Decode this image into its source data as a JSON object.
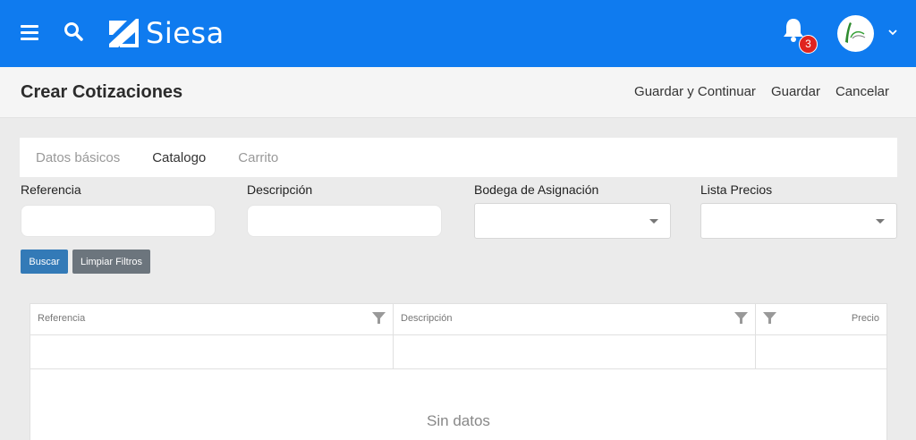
{
  "app": {
    "brand": "Siesa",
    "notifications_count": "3"
  },
  "header": {
    "title": "Crear Cotizaciones",
    "actions": [
      "Guardar y Continuar",
      "Guardar",
      "Cancelar"
    ]
  },
  "tabs": [
    {
      "label": "Datos básicos",
      "active": false
    },
    {
      "label": "Catalogo",
      "active": true
    },
    {
      "label": "Carrito",
      "active": false
    }
  ],
  "filters": {
    "referencia": {
      "label": "Referencia",
      "value": "",
      "placeholder": ""
    },
    "descripcion": {
      "label": "Descripción",
      "value": "",
      "placeholder": ""
    },
    "bodega": {
      "label": "Bodega de Asignación",
      "selected": ""
    },
    "lista_precios": {
      "label": "Lista Precios",
      "selected": ""
    }
  },
  "buttons": {
    "buscar": "Buscar",
    "limpiar": "Limpiar Filtros"
  },
  "grid": {
    "columns": [
      "Referencia",
      "Descripción",
      "Precio"
    ],
    "empty_text": "Sin datos"
  },
  "colors": {
    "topbar": "#0f7bef",
    "badge": "#e0241f",
    "primary_button": "#337ab7",
    "secondary_button": "#6c757d"
  }
}
